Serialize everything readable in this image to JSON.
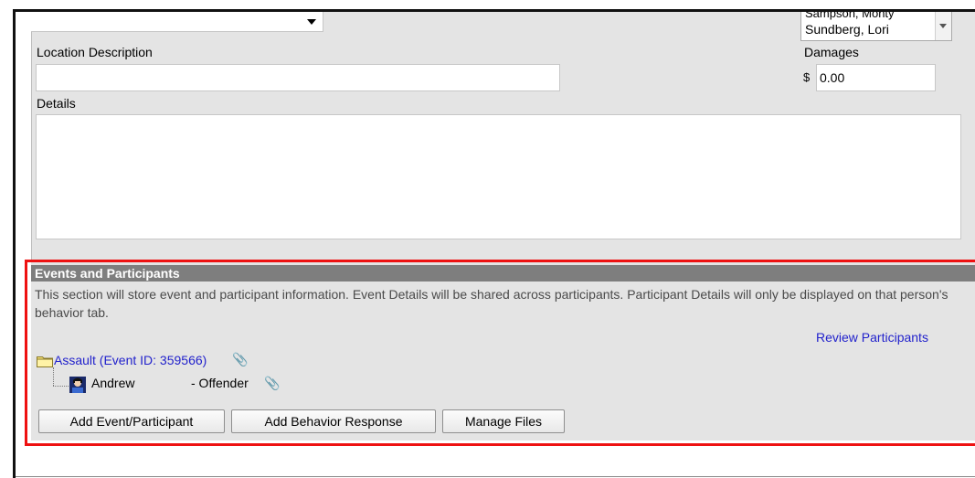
{
  "form": {
    "location_description_label": "Location Description",
    "location_description_value": "",
    "damages_label": "Damages",
    "damages_currency": "$",
    "damages_value": "0.00",
    "details_label": "Details",
    "details_value": "",
    "staff_select_partial": "Sampson, Monty",
    "staff_select_value": "Sundberg, Lori"
  },
  "events": {
    "header": "Events and Participants",
    "description": "This section will store event and participant information. Event Details will be shared across participants. Participant Details will only be displayed on that person's behavior tab.",
    "review_link": "Review Participants",
    "event_label": "Assault (Event ID: 359566)",
    "participant_name": "Andrew",
    "participant_role": "- Offender"
  },
  "buttons": {
    "add_event": "Add Event/Participant",
    "add_behavior": "Add Behavior Response",
    "manage_files": "Manage Files"
  },
  "colors": {
    "link": "#2222cc",
    "header_bg": "#7e7e7e",
    "highlight": "#ee1111",
    "panel_bg": "#e4e4e4"
  }
}
